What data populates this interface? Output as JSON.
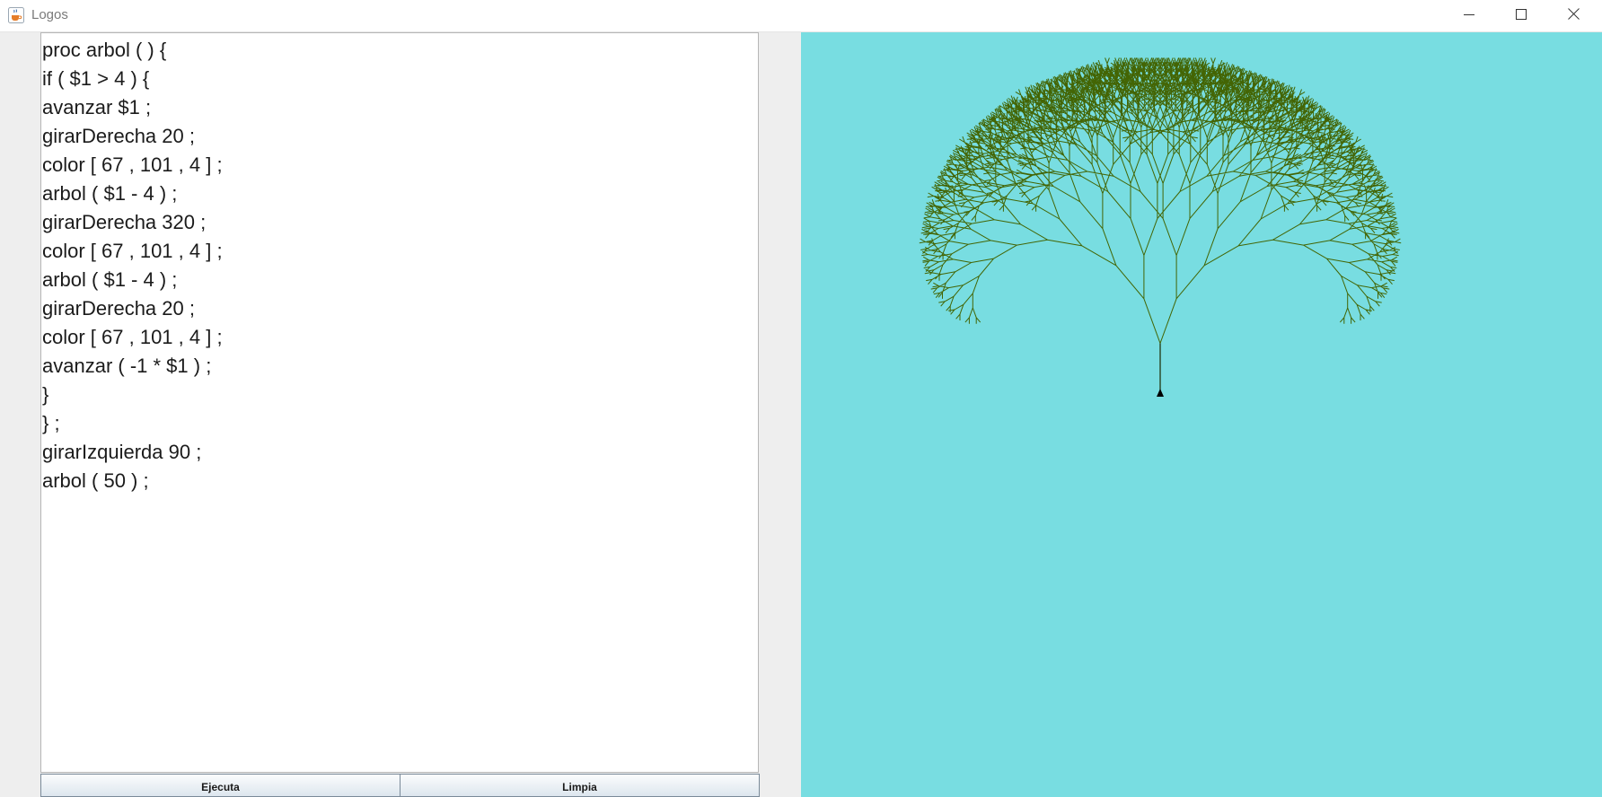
{
  "window": {
    "title": "Logos"
  },
  "editor": {
    "lines": [
      "proc arbol ( ) {",
      "if ( $1 > 4 ) {",
      "avanzar $1 ;",
      "girarDerecha 20 ;",
      "color [ 67 , 101 , 4 ] ;",
      "arbol ( $1 - 4 ) ;",
      "girarDerecha 320 ;",
      "color [ 67 , 101 , 4 ] ;",
      "arbol ( $1 - 4 ) ;",
      "girarDerecha 20 ;",
      "color [ 67 , 101 , 4 ] ;",
      "avanzar ( -1 * $1 ) ;",
      "}",
      "} ;",
      "girarIzquierda 90 ;",
      "arbol ( 50 ) ;"
    ]
  },
  "buttons": {
    "run_label": "Ejecuta",
    "clear_label": "Limpia"
  },
  "canvas": {
    "background_color": "#78dde1",
    "branch_color": "#436504",
    "turtle_color": "#000000"
  },
  "icons": {
    "app": "java-coffee-cup-icon",
    "minimize": "minimize-icon",
    "maximize": "maximize-icon",
    "close": "close-icon"
  }
}
